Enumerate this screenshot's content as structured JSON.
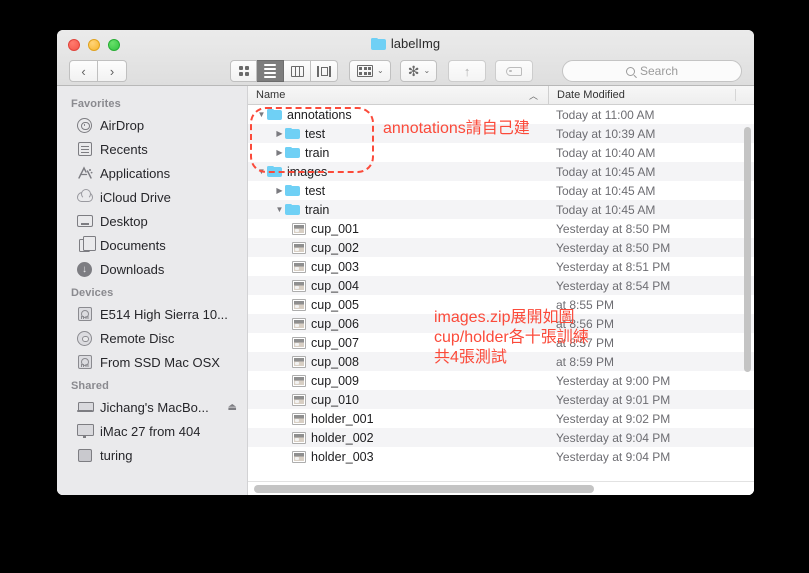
{
  "window": {
    "title": "labelImg",
    "traffic_lights": [
      "close",
      "minimize",
      "zoom"
    ]
  },
  "toolbar": {
    "back_label": "‹",
    "forward_label": "›",
    "view_modes": [
      {
        "name": "icon-view",
        "active": false
      },
      {
        "name": "list-view",
        "active": true
      },
      {
        "name": "column-view",
        "active": false
      },
      {
        "name": "coverflow-view",
        "active": false
      }
    ],
    "arrange_label": "",
    "action_label": "",
    "share_label": "",
    "tags_label": "",
    "caret": "⌄",
    "gear": "✻",
    "share_glyph": "↑"
  },
  "search": {
    "placeholder": "Search"
  },
  "sidebar": {
    "sections": [
      {
        "header": "Favorites",
        "items": [
          {
            "label": "AirDrop",
            "icon": "airdrop-icon"
          },
          {
            "label": "Recents",
            "icon": "recents-icon"
          },
          {
            "label": "Applications",
            "icon": "applications-icon"
          },
          {
            "label": "iCloud Drive",
            "icon": "icloud-icon"
          },
          {
            "label": "Desktop",
            "icon": "desktop-icon"
          },
          {
            "label": "Documents",
            "icon": "documents-icon"
          },
          {
            "label": "Downloads",
            "icon": "downloads-icon"
          }
        ]
      },
      {
        "header": "Devices",
        "items": [
          {
            "label": "E514 High Sierra 10...",
            "icon": "harddrive-icon"
          },
          {
            "label": "Remote Disc",
            "icon": "disc-icon"
          },
          {
            "label": "From SSD Mac OSX",
            "icon": "harddrive-icon"
          }
        ]
      },
      {
        "header": "Shared",
        "items": [
          {
            "label": "Jichang's MacBo...",
            "icon": "laptop-icon",
            "eject": "⏏"
          },
          {
            "label": "iMac 27 from 404",
            "icon": "imac-icon"
          },
          {
            "label": "turing",
            "icon": "server-icon"
          }
        ]
      }
    ]
  },
  "file_list": {
    "columns": [
      {
        "label": "Name",
        "sorted": true,
        "sort_glyph": "︿"
      },
      {
        "label": "Date Modified"
      }
    ],
    "rows": [
      {
        "name": "annotations",
        "date": "Today at 11:00 AM",
        "type": "folder",
        "depth": 1,
        "disclosure": "open"
      },
      {
        "name": "test",
        "date": "Today at 10:39 AM",
        "type": "folder",
        "depth": 2,
        "disclosure": "closed"
      },
      {
        "name": "train",
        "date": "Today at 10:40 AM",
        "type": "folder",
        "depth": 2,
        "disclosure": "closed"
      },
      {
        "name": "images",
        "date": "Today at 10:45 AM",
        "type": "folder",
        "depth": 1,
        "disclosure": "open"
      },
      {
        "name": "test",
        "date": "Today at 10:45 AM",
        "type": "folder",
        "depth": 2,
        "disclosure": "closed"
      },
      {
        "name": "train",
        "date": "Today at 10:45 AM",
        "type": "folder",
        "depth": 2,
        "disclosure": "open"
      },
      {
        "name": "cup_001",
        "date": "Yesterday at 8:50 PM",
        "type": "image",
        "depth": 3,
        "disclosure": "none"
      },
      {
        "name": "cup_002",
        "date": "Yesterday at 8:50 PM",
        "type": "image",
        "depth": 3,
        "disclosure": "none"
      },
      {
        "name": "cup_003",
        "date": "Yesterday at 8:51 PM",
        "type": "image",
        "depth": 3,
        "disclosure": "none"
      },
      {
        "name": "cup_004",
        "date": "Yesterday at 8:54 PM",
        "type": "image",
        "depth": 3,
        "disclosure": "none"
      },
      {
        "name": "cup_005",
        "date": "at 8:55 PM",
        "type": "image",
        "depth": 3,
        "disclosure": "none"
      },
      {
        "name": "cup_006",
        "date": "at 8:56 PM",
        "type": "image",
        "depth": 3,
        "disclosure": "none"
      },
      {
        "name": "cup_007",
        "date": "at 8:57 PM",
        "type": "image",
        "depth": 3,
        "disclosure": "none"
      },
      {
        "name": "cup_008",
        "date": "at 8:59 PM",
        "type": "image",
        "depth": 3,
        "disclosure": "none"
      },
      {
        "name": "cup_009",
        "date": "Yesterday at 9:00 PM",
        "type": "image",
        "depth": 3,
        "disclosure": "none"
      },
      {
        "name": "cup_010",
        "date": "Yesterday at 9:01 PM",
        "type": "image",
        "depth": 3,
        "disclosure": "none"
      },
      {
        "name": "holder_001",
        "date": "Yesterday at 9:02 PM",
        "type": "image",
        "depth": 3,
        "disclosure": "none"
      },
      {
        "name": "holder_002",
        "date": "Yesterday at 9:04 PM",
        "type": "image",
        "depth": 3,
        "disclosure": "none"
      },
      {
        "name": "holder_003",
        "date": "Yesterday at 9:04 PM",
        "type": "image",
        "depth": 3,
        "disclosure": "none"
      }
    ]
  },
  "annotations": {
    "color": "#fb4a3a",
    "note_annotations": "annotations請自己建",
    "note_images": "images.zip展開如圖\ncup/holder各十張訓練\n共4張測試"
  }
}
